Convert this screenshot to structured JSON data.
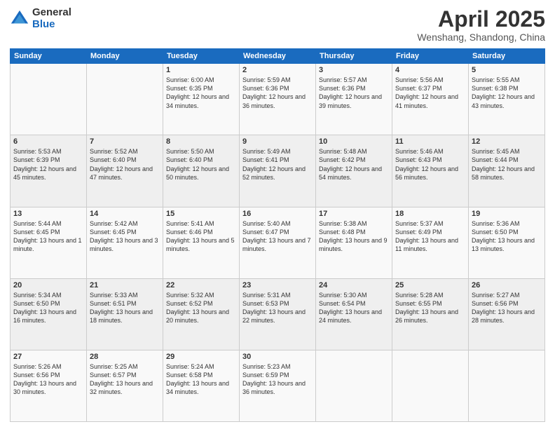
{
  "logo": {
    "general": "General",
    "blue": "Blue"
  },
  "title": "April 2025",
  "subtitle": "Wenshang, Shandong, China",
  "days_header": [
    "Sunday",
    "Monday",
    "Tuesday",
    "Wednesday",
    "Thursday",
    "Friday",
    "Saturday"
  ],
  "weeks": [
    [
      {
        "day": "",
        "sunrise": "",
        "sunset": "",
        "daylight": ""
      },
      {
        "day": "",
        "sunrise": "",
        "sunset": "",
        "daylight": ""
      },
      {
        "day": "1",
        "sunrise": "Sunrise: 6:00 AM",
        "sunset": "Sunset: 6:35 PM",
        "daylight": "Daylight: 12 hours and 34 minutes."
      },
      {
        "day": "2",
        "sunrise": "Sunrise: 5:59 AM",
        "sunset": "Sunset: 6:36 PM",
        "daylight": "Daylight: 12 hours and 36 minutes."
      },
      {
        "day": "3",
        "sunrise": "Sunrise: 5:57 AM",
        "sunset": "Sunset: 6:36 PM",
        "daylight": "Daylight: 12 hours and 39 minutes."
      },
      {
        "day": "4",
        "sunrise": "Sunrise: 5:56 AM",
        "sunset": "Sunset: 6:37 PM",
        "daylight": "Daylight: 12 hours and 41 minutes."
      },
      {
        "day": "5",
        "sunrise": "Sunrise: 5:55 AM",
        "sunset": "Sunset: 6:38 PM",
        "daylight": "Daylight: 12 hours and 43 minutes."
      }
    ],
    [
      {
        "day": "6",
        "sunrise": "Sunrise: 5:53 AM",
        "sunset": "Sunset: 6:39 PM",
        "daylight": "Daylight: 12 hours and 45 minutes."
      },
      {
        "day": "7",
        "sunrise": "Sunrise: 5:52 AM",
        "sunset": "Sunset: 6:40 PM",
        "daylight": "Daylight: 12 hours and 47 minutes."
      },
      {
        "day": "8",
        "sunrise": "Sunrise: 5:50 AM",
        "sunset": "Sunset: 6:40 PM",
        "daylight": "Daylight: 12 hours and 50 minutes."
      },
      {
        "day": "9",
        "sunrise": "Sunrise: 5:49 AM",
        "sunset": "Sunset: 6:41 PM",
        "daylight": "Daylight: 12 hours and 52 minutes."
      },
      {
        "day": "10",
        "sunrise": "Sunrise: 5:48 AM",
        "sunset": "Sunset: 6:42 PM",
        "daylight": "Daylight: 12 hours and 54 minutes."
      },
      {
        "day": "11",
        "sunrise": "Sunrise: 5:46 AM",
        "sunset": "Sunset: 6:43 PM",
        "daylight": "Daylight: 12 hours and 56 minutes."
      },
      {
        "day": "12",
        "sunrise": "Sunrise: 5:45 AM",
        "sunset": "Sunset: 6:44 PM",
        "daylight": "Daylight: 12 hours and 58 minutes."
      }
    ],
    [
      {
        "day": "13",
        "sunrise": "Sunrise: 5:44 AM",
        "sunset": "Sunset: 6:45 PM",
        "daylight": "Daylight: 13 hours and 1 minute."
      },
      {
        "day": "14",
        "sunrise": "Sunrise: 5:42 AM",
        "sunset": "Sunset: 6:45 PM",
        "daylight": "Daylight: 13 hours and 3 minutes."
      },
      {
        "day": "15",
        "sunrise": "Sunrise: 5:41 AM",
        "sunset": "Sunset: 6:46 PM",
        "daylight": "Daylight: 13 hours and 5 minutes."
      },
      {
        "day": "16",
        "sunrise": "Sunrise: 5:40 AM",
        "sunset": "Sunset: 6:47 PM",
        "daylight": "Daylight: 13 hours and 7 minutes."
      },
      {
        "day": "17",
        "sunrise": "Sunrise: 5:38 AM",
        "sunset": "Sunset: 6:48 PM",
        "daylight": "Daylight: 13 hours and 9 minutes."
      },
      {
        "day": "18",
        "sunrise": "Sunrise: 5:37 AM",
        "sunset": "Sunset: 6:49 PM",
        "daylight": "Daylight: 13 hours and 11 minutes."
      },
      {
        "day": "19",
        "sunrise": "Sunrise: 5:36 AM",
        "sunset": "Sunset: 6:50 PM",
        "daylight": "Daylight: 13 hours and 13 minutes."
      }
    ],
    [
      {
        "day": "20",
        "sunrise": "Sunrise: 5:34 AM",
        "sunset": "Sunset: 6:50 PM",
        "daylight": "Daylight: 13 hours and 16 minutes."
      },
      {
        "day": "21",
        "sunrise": "Sunrise: 5:33 AM",
        "sunset": "Sunset: 6:51 PM",
        "daylight": "Daylight: 13 hours and 18 minutes."
      },
      {
        "day": "22",
        "sunrise": "Sunrise: 5:32 AM",
        "sunset": "Sunset: 6:52 PM",
        "daylight": "Daylight: 13 hours and 20 minutes."
      },
      {
        "day": "23",
        "sunrise": "Sunrise: 5:31 AM",
        "sunset": "Sunset: 6:53 PM",
        "daylight": "Daylight: 13 hours and 22 minutes."
      },
      {
        "day": "24",
        "sunrise": "Sunrise: 5:30 AM",
        "sunset": "Sunset: 6:54 PM",
        "daylight": "Daylight: 13 hours and 24 minutes."
      },
      {
        "day": "25",
        "sunrise": "Sunrise: 5:28 AM",
        "sunset": "Sunset: 6:55 PM",
        "daylight": "Daylight: 13 hours and 26 minutes."
      },
      {
        "day": "26",
        "sunrise": "Sunrise: 5:27 AM",
        "sunset": "Sunset: 6:56 PM",
        "daylight": "Daylight: 13 hours and 28 minutes."
      }
    ],
    [
      {
        "day": "27",
        "sunrise": "Sunrise: 5:26 AM",
        "sunset": "Sunset: 6:56 PM",
        "daylight": "Daylight: 13 hours and 30 minutes."
      },
      {
        "day": "28",
        "sunrise": "Sunrise: 5:25 AM",
        "sunset": "Sunset: 6:57 PM",
        "daylight": "Daylight: 13 hours and 32 minutes."
      },
      {
        "day": "29",
        "sunrise": "Sunrise: 5:24 AM",
        "sunset": "Sunset: 6:58 PM",
        "daylight": "Daylight: 13 hours and 34 minutes."
      },
      {
        "day": "30",
        "sunrise": "Sunrise: 5:23 AM",
        "sunset": "Sunset: 6:59 PM",
        "daylight": "Daylight: 13 hours and 36 minutes."
      },
      {
        "day": "",
        "sunrise": "",
        "sunset": "",
        "daylight": ""
      },
      {
        "day": "",
        "sunrise": "",
        "sunset": "",
        "daylight": ""
      },
      {
        "day": "",
        "sunrise": "",
        "sunset": "",
        "daylight": ""
      }
    ]
  ]
}
